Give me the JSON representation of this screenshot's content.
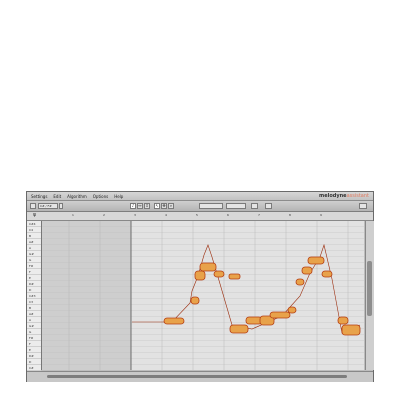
{
  "menu": [
    "Settings",
    "Edit",
    "Algorithm",
    "Options",
    "Help"
  ],
  "brand": {
    "name": "melodyne",
    "edition": "assistant"
  },
  "toolbar": {
    "key_select": "C# / F#"
  },
  "ruler": [
    "1",
    "2",
    "3",
    "4",
    "5",
    "6",
    "7",
    "8",
    "9"
  ],
  "pitch_labels": [
    "C#4",
    "C4",
    "B",
    "A#",
    "A",
    "G#",
    "G",
    "F#",
    "F",
    "E",
    "D#",
    "D",
    "C#3",
    "C3",
    "B",
    "A#",
    "A",
    "G#",
    "G",
    "F#",
    "F",
    "E",
    "D#",
    "D",
    "C#"
  ],
  "colors": {
    "blob_outer": "#e8a24a",
    "blob_core": "#b53d12",
    "pitch_line": "#9a2a0a",
    "selection": "#bdbdbd"
  }
}
